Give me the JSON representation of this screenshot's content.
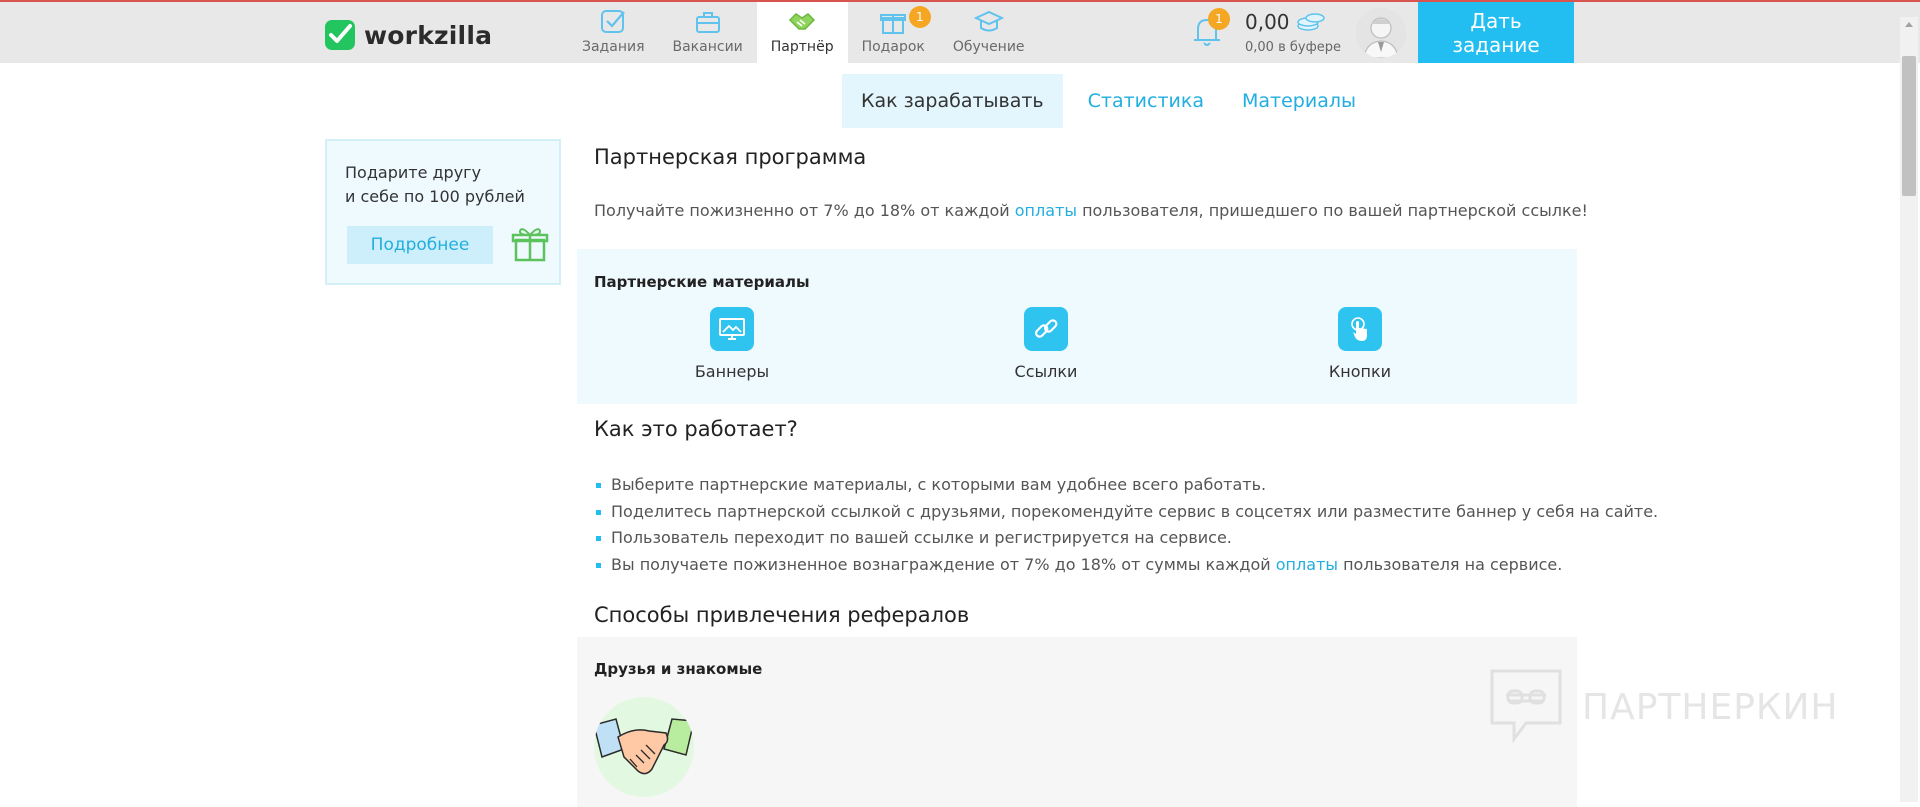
{
  "brand": {
    "name": "workzilla",
    "accent": "#22bef2",
    "logo_green": "#22c55e"
  },
  "nav": {
    "items": [
      {
        "id": "tasks",
        "label": "Задания",
        "icon": "checkbox-icon"
      },
      {
        "id": "vacancies",
        "label": "Вакансии",
        "icon": "briefcase-icon"
      },
      {
        "id": "partner",
        "label": "Партнёр",
        "icon": "handshake-icon",
        "active": true
      },
      {
        "id": "gift",
        "label": "Подарок",
        "icon": "gift-icon",
        "badge": "1"
      },
      {
        "id": "learning",
        "label": "Обучение",
        "icon": "graduation-cap-icon"
      }
    ]
  },
  "header": {
    "notifications_badge": "1",
    "balance": "0,00",
    "buffer": "0,00 в буфере",
    "give_task": "Дать задание"
  },
  "subtabs": [
    {
      "label": "Как зарабатывать",
      "active": true
    },
    {
      "label": "Статистика"
    },
    {
      "label": "Материалы"
    }
  ],
  "promo": {
    "line1": "Подарите другу",
    "line2": "и себе по 100 рублей",
    "button": "Подробнее"
  },
  "program": {
    "title": "Партнерская программа",
    "text_before": "Получайте пожизненно от 7% до 18% от каждой ",
    "text_link": "оплаты",
    "text_after": " пользователя, пришедшего по вашей партнерской ссылке!"
  },
  "materials": {
    "title": "Партнерские материалы",
    "items": [
      {
        "label": "Баннеры",
        "icon": "banner-icon"
      },
      {
        "label": "Ссылки",
        "icon": "link-icon"
      },
      {
        "label": "Кнопки",
        "icon": "pointer-icon"
      }
    ]
  },
  "how": {
    "title": "Как это работает?",
    "steps": [
      "Выберите партнерские материалы, с которыми вам удобнее всего работать.",
      "Поделитесь партнерской ссылкой с друзьями, порекомендуйте сервис в соцсетях или разместите баннер у себя на сайте.",
      "Пользователь переходит по вашей ссылке и регистрируется на сервисе."
    ],
    "last_before": "Вы получаете пожизненное вознаграждение от 7% до 18% от суммы каждой ",
    "last_link": "оплаты",
    "last_after": " пользователя на сервисе."
  },
  "ways": {
    "title": "Способы привлечения рефералов",
    "item_title": "Друзья и знакомые"
  },
  "watermark": "ПАРТНЕРКИН"
}
